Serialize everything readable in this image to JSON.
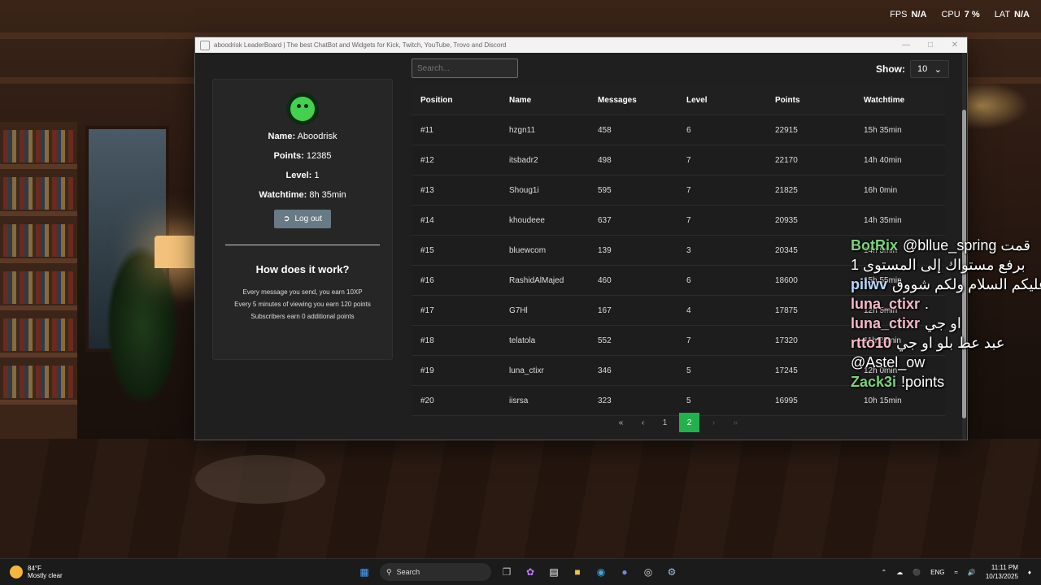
{
  "perf": {
    "fps_label": "FPS",
    "fps_value": "N/A",
    "cpu_label": "CPU",
    "cpu_value": "7 %",
    "lat_label": "LAT",
    "lat_value": "N/A"
  },
  "window": {
    "title": "aboodrisk LeaderBoard | The best ChatBot and Widgets for Kick, Twitch, YouTube, Trovo and Discord"
  },
  "profile": {
    "name_label": "Name:",
    "name_value": "Aboodrisk",
    "points_label": "Points:",
    "points_value": "12385",
    "level_label": "Level:",
    "level_value": "1",
    "watch_label": "Watchtime:",
    "watch_value": "8h 35min",
    "logout_label": "Log out",
    "how_title": "How does it work?",
    "how_lines": [
      "Every message you send, you earn 10XP",
      "Every 5 minutes of viewing you earn 120 points",
      "Subscribers earn 0 additional points"
    ]
  },
  "search": {
    "placeholder": "Search..."
  },
  "show": {
    "label": "Show:",
    "value": "10"
  },
  "table": {
    "headers": [
      "Position",
      "Name",
      "Messages",
      "Level",
      "Points",
      "Watchtime"
    ],
    "rows": [
      [
        "#11",
        "hzgn11",
        "458",
        "6",
        "22915",
        "15h 35min"
      ],
      [
        "#12",
        "itsbadr2",
        "498",
        "7",
        "22170",
        "14h 40min"
      ],
      [
        "#13",
        "Shoug1i",
        "595",
        "7",
        "21825",
        "16h 0min"
      ],
      [
        "#14",
        "khoudeee",
        "637",
        "7",
        "20935",
        "14h 35min"
      ],
      [
        "#15",
        "bluewcom",
        "139",
        "3",
        "20345",
        "14h 5min"
      ],
      [
        "#16",
        "RashidAlMajed",
        "460",
        "6",
        "18600",
        "15h 55min"
      ],
      [
        "#17",
        "G7Hl",
        "167",
        "4",
        "17875",
        "12h 5min"
      ],
      [
        "#18",
        "telatola",
        "552",
        "7",
        "17320",
        "11h 25min"
      ],
      [
        "#19",
        "luna_ctixr",
        "346",
        "5",
        "17245",
        "12h 0min"
      ],
      [
        "#20",
        "iisrsa",
        "323",
        "5",
        "16995",
        "10h 15min"
      ]
    ]
  },
  "pager": {
    "first": "«",
    "prev": "‹",
    "pages": [
      "1",
      "2"
    ],
    "next": "›",
    "last": "»",
    "active": "2"
  },
  "chat": [
    {
      "user": "BotRix",
      "color": "#7bd17b",
      "msg": "@bllue_spring قمت"
    },
    {
      "user": "",
      "color": "#ffffff",
      "msg": "برفع مستواك إلى المستوى 1"
    },
    {
      "user": "pilwv",
      "color": "#b8d8ff",
      "msg": "وعليكم السلام ولكم شووق"
    },
    {
      "user": "luna_ctixr",
      "color": "#f7b9c8",
      "msg": "."
    },
    {
      "user": "luna_ctixr",
      "color": "#f7b9c8",
      "msg": "او جي"
    },
    {
      "user": "rtto10",
      "color": "#f7b9c8",
      "msg": "عبد عط بلو او جي"
    },
    {
      "user": "",
      "color": "#ffffff",
      "msg": "@Astel_ow"
    },
    {
      "user": "Zack3i",
      "color": "#7bd17b",
      "msg": "!points"
    }
  ],
  "taskbar": {
    "temp": "84°F",
    "condition": "Mostly clear",
    "search": "Search",
    "lang": "ENG",
    "time": "11:11 PM",
    "date": "10/13/2025"
  }
}
